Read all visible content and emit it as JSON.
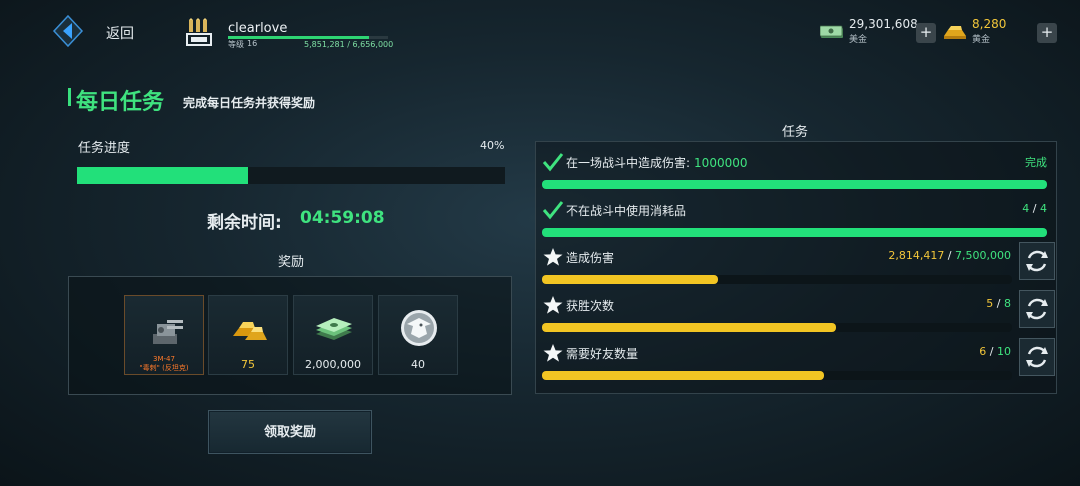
{
  "header": {
    "back_label": "返回",
    "player_name": "clearlove",
    "level_label": "等级",
    "level": "16",
    "xp_text": "5,851,281 / 6,656,000",
    "xp_fraction": 0.879,
    "cash_value": "29,301,608",
    "cash_label": "美金",
    "gold_value": "8,280",
    "gold_label": "黄金",
    "plus_symbol": "+"
  },
  "title": {
    "main": "每日任务",
    "subtitle": "完成每日任务并获得奖励"
  },
  "progress": {
    "label": "任务进度",
    "percent_text": "40%",
    "fraction": 0.4,
    "time_label": "剩余时间:",
    "time_value": "04:59:08"
  },
  "rewards": {
    "heading": "奖励",
    "items": [
      {
        "icon": "turret-icon",
        "qty": "3M-47\n\"毒刺\" (反坦克)"
      },
      {
        "icon": "gold-bars-icon",
        "qty": "75"
      },
      {
        "icon": "cash-stack-icon",
        "qty": "2,000,000"
      },
      {
        "icon": "eagle-emblem-icon",
        "qty": "40"
      }
    ],
    "claim_label": "领取奖励"
  },
  "tasks": {
    "heading": "任务",
    "items": [
      {
        "icon": "check-icon",
        "name": "在一场战斗中造成伤害:",
        "name_num": "1000000",
        "status": "完成",
        "current": "",
        "sep": "",
        "target": "",
        "fraction": 1.0,
        "color": "green",
        "refresh": false
      },
      {
        "icon": "check-icon",
        "name": "不在战斗中使用消耗品",
        "name_num": "",
        "status": "",
        "current": "4",
        "sep": " / ",
        "target": "4",
        "fraction": 1.0,
        "color": "green",
        "refresh": false
      },
      {
        "icon": "star-icon",
        "name": "造成伤害",
        "name_num": "",
        "status": "",
        "current": "2,814,417",
        "sep": " / ",
        "target": "7,500,000",
        "fraction": 0.375,
        "color": "yellow",
        "refresh": true
      },
      {
        "icon": "star-icon",
        "name": "获胜次数",
        "name_num": "",
        "status": "",
        "current": "5",
        "sep": " / ",
        "target": "8",
        "fraction": 0.625,
        "color": "yellow",
        "refresh": true
      },
      {
        "icon": "star-icon",
        "name": "需要好友数量",
        "name_num": "",
        "status": "",
        "current": "6",
        "sep": " / ",
        "target": "10",
        "fraction": 0.6,
        "color": "yellow",
        "refresh": true
      }
    ]
  },
  "colors": {
    "accent_green": "#3fe37f",
    "bar_green": "#22e07a",
    "bar_yellow": "#f2c523",
    "gold": "#f2c63a"
  }
}
